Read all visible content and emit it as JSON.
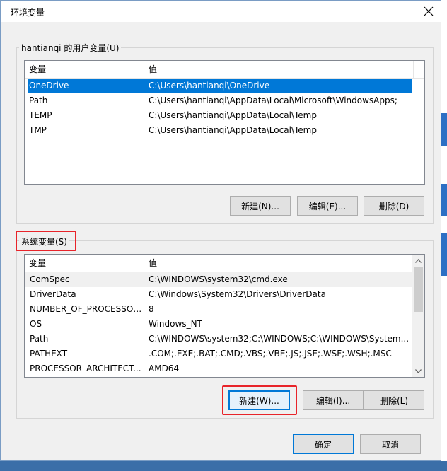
{
  "dialog": {
    "title": "环境变量"
  },
  "user_vars": {
    "group_label": "hantianqi 的用户变量(U)",
    "columns": [
      "变量",
      "值"
    ],
    "rows": [
      {
        "name": "OneDrive",
        "value": "C:\\Users\\hantianqi\\OneDrive",
        "selected": true
      },
      {
        "name": "Path",
        "value": "C:\\Users\\hantianqi\\AppData\\Local\\Microsoft\\WindowsApps;"
      },
      {
        "name": "TEMP",
        "value": "C:\\Users\\hantianqi\\AppData\\Local\\Temp"
      },
      {
        "name": "TMP",
        "value": "C:\\Users\\hantianqi\\AppData\\Local\\Temp"
      }
    ],
    "buttons": {
      "new": "新建(N)...",
      "edit": "编辑(E)...",
      "delete": "删除(D)"
    }
  },
  "system_vars": {
    "group_label": "系统变量(S)",
    "columns": [
      "变量",
      "值"
    ],
    "rows": [
      {
        "name": "ComSpec",
        "value": "C:\\WINDOWS\\system32\\cmd.exe"
      },
      {
        "name": "DriverData",
        "value": "C:\\Windows\\System32\\Drivers\\DriverData"
      },
      {
        "name": "NUMBER_OF_PROCESSORS",
        "value": "8"
      },
      {
        "name": "OS",
        "value": "Windows_NT"
      },
      {
        "name": "Path",
        "value": "C:\\WINDOWS\\system32;C:\\WINDOWS;C:\\WINDOWS\\System..."
      },
      {
        "name": "PATHEXT",
        "value": ".COM;.EXE;.BAT;.CMD;.VBS;.VBE;.JS;.JSE;.WSF;.WSH;.MSC"
      },
      {
        "name": "PROCESSOR_ARCHITECT...",
        "value": "AMD64"
      }
    ],
    "buttons": {
      "new": "新建(W)...",
      "edit": "编辑(I)...",
      "delete": "删除(L)"
    }
  },
  "footer": {
    "ok": "确定",
    "cancel": "取消"
  },
  "colors": {
    "selection": "#0078d7",
    "highlight_box": "#e8242a"
  }
}
